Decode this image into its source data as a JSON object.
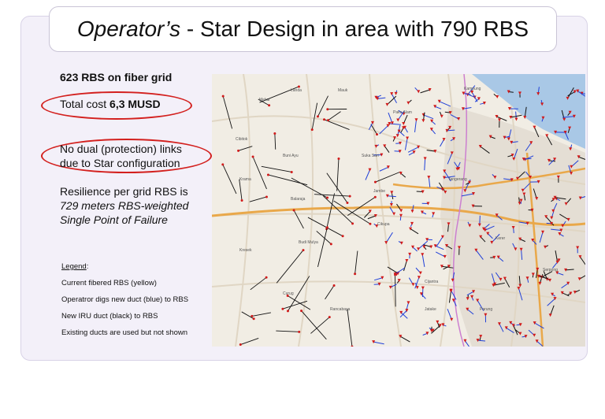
{
  "title": {
    "italic_part": "Operator’s",
    "rest": " - Star Design in area with 790 RBS"
  },
  "left": {
    "rbs_on_grid": "623 RBS on fiber grid",
    "cost_label": "Total cost ",
    "cost_value": "6,3 MUSD",
    "dual_line1": "No dual (protection) links",
    "dual_line2": "due to Star configuration",
    "resilience_line1": "Resilience per grid RBS is",
    "resilience_line2": "729 meters RBS-weighted",
    "resilience_line3": "Single Point of Failure"
  },
  "legend": {
    "title": "Legend",
    "colon": ":",
    "items": [
      "Current fibered RBS (yellow)",
      "Operatror digs new duct (blue) to RBS",
      "New IRU duct (black) to RBS",
      "Existing ducts are used but not shown"
    ]
  },
  "map": {
    "place_labels": [
      "Landa",
      "Mauk",
      "Kampung",
      "Mekar",
      "Paku Alam",
      "Cibitok",
      "Buni Ayu",
      "Suka Sari",
      "Tangerang",
      "Krama",
      "Balaraja",
      "Jambe",
      "Kresek",
      "Cikupa",
      "Budi Mulya",
      "Kerer",
      "Cijantra",
      "Serpong",
      "Curug",
      "Jatake",
      "Parung",
      "Rancabaya"
    ],
    "colors": {
      "land": "#f1ede4",
      "sea": "#a9c8e6",
      "road": "#e9a84a",
      "road_minor": "#e0d6c4",
      "new_duct": "#1f3fd8",
      "iru_duct": "#111111",
      "rbs": "#d11a1a"
    }
  }
}
